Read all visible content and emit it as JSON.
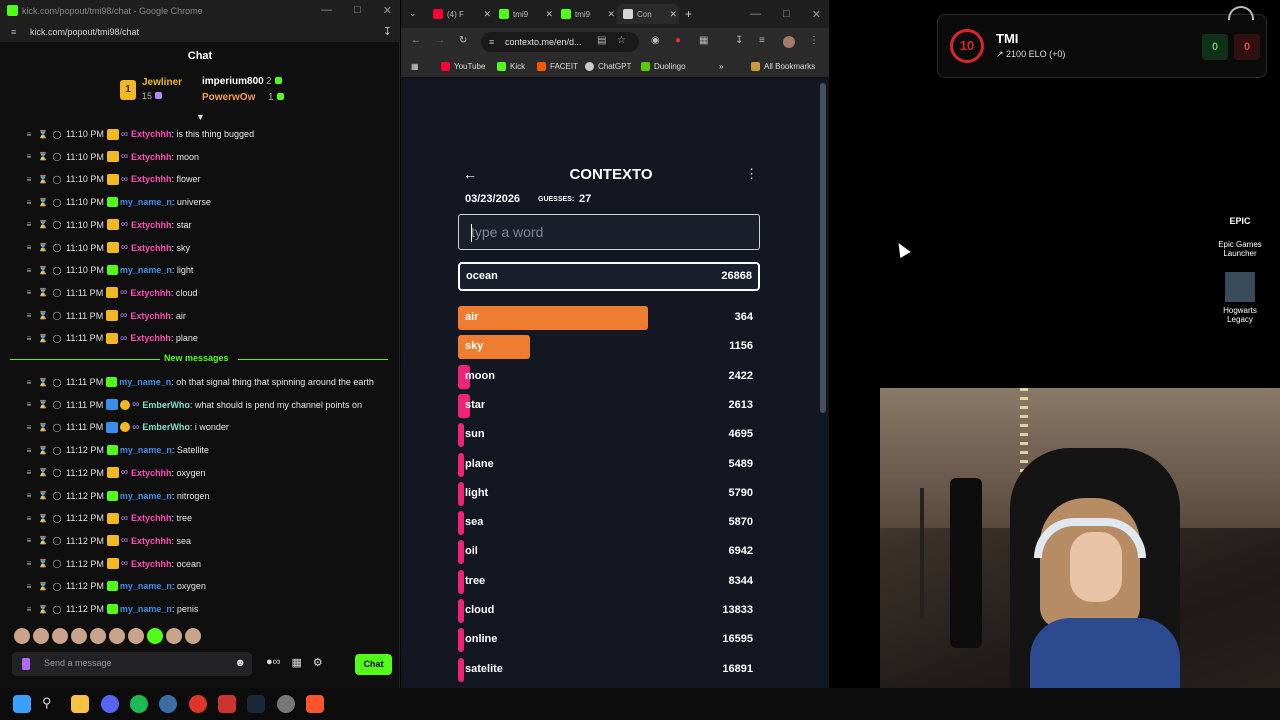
{
  "chat_window": {
    "title": "kick.com/popout/tmi98/chat - Google Chrome",
    "url": "kick.com/popout/tmi98/chat",
    "header": "Chat",
    "leaderboard": {
      "first": {
        "rank": "1",
        "name": "Jewliner",
        "count": "15"
      },
      "second": {
        "name": "imperium800",
        "count": "2"
      },
      "third": {
        "name": "PowerwOw",
        "count": "1"
      }
    },
    "messages_before": [
      {
        "time": "11:10 PM",
        "user": "Extychhh",
        "text": ": is this thing bugged",
        "badge": "crown"
      },
      {
        "time": "11:10 PM",
        "user": "Extychhh",
        "text": ": moon",
        "badge": "crown"
      },
      {
        "time": "11:10 PM",
        "user": "Extychhh",
        "text": ": flower",
        "badge": "crown"
      },
      {
        "time": "11:10 PM",
        "user": "my_name_n",
        "text": ": universe",
        "badge": "green"
      },
      {
        "time": "11:10 PM",
        "user": "Extychhh",
        "text": ": star",
        "badge": "crown"
      },
      {
        "time": "11:10 PM",
        "user": "Extychhh",
        "text": ": sky",
        "badge": "crown"
      },
      {
        "time": "11:10 PM",
        "user": "my_name_n",
        "text": ": light",
        "badge": "green"
      },
      {
        "time": "11:11 PM",
        "user": "Extychhh",
        "text": ": cloud",
        "badge": "crown"
      },
      {
        "time": "11:11 PM",
        "user": "Extychhh",
        "text": ": air",
        "badge": "crown"
      },
      {
        "time": "11:11 PM",
        "user": "Extychhh",
        "text": ": plane",
        "badge": "crown"
      }
    ],
    "new_messages_label": "New messages",
    "messages_after": [
      {
        "time": "11:11 PM",
        "user": "my_name_n",
        "text": ": oh that signal thing that spinning around the earth",
        "badge": "green"
      },
      {
        "time": "11:11 PM",
        "user": "EmberWho",
        "text": ": what should is pend my channel points on",
        "badge": "blue"
      },
      {
        "time": "11:11 PM",
        "user": "EmberWho",
        "text": ": i wonder",
        "badge": "blue"
      },
      {
        "time": "11:12 PM",
        "user": "my_name_n",
        "text": ": Satellite",
        "badge": "green"
      },
      {
        "time": "11:12 PM",
        "user": "Extychhh",
        "text": ": oxygen",
        "badge": "crown"
      },
      {
        "time": "11:12 PM",
        "user": "my_name_n",
        "text": ": nitrogen",
        "badge": "green"
      },
      {
        "time": "11:12 PM",
        "user": "Extychhh",
        "text": ": tree",
        "badge": "crown"
      },
      {
        "time": "11:12 PM",
        "user": "Extychhh",
        "text": ": sea",
        "badge": "crown"
      },
      {
        "time": "11:12 PM",
        "user": "Extychhh",
        "text": ": ocean",
        "badge": "crown"
      },
      {
        "time": "11:12 PM",
        "user": "my_name_n",
        "text": ": oxygen",
        "badge": "green"
      },
      {
        "time": "11:12 PM",
        "user": "my_name_n",
        "text": ": penis",
        "badge": "green"
      }
    ],
    "send_placeholder": "Send a message",
    "send_button": "Chat"
  },
  "browser": {
    "tabs": [
      "(4) F",
      "tmi9",
      "tmi9",
      "Con"
    ],
    "url": "contexto.me/en/d...",
    "bookmarks": [
      "YouTube",
      "Kick",
      "FACEIT",
      "ChatGPT",
      "Duolingo",
      "All Bookmarks"
    ]
  },
  "contexto": {
    "title": "CONTEXTO",
    "date": "03/23/2026",
    "guesses_label": "GUESSES:",
    "guesses": "27",
    "input_placeholder": "type a word",
    "last_guess": {
      "word": "ocean",
      "rank": "26868"
    },
    "guesses_list": [
      {
        "word": "air",
        "rank": "364",
        "fill": 0.63,
        "color": "#ef7d31"
      },
      {
        "word": "sky",
        "rank": "1156",
        "fill": 0.24,
        "color": "#ef7d31"
      },
      {
        "word": "moon",
        "rank": "2422",
        "fill": 0.04,
        "color": "#ef2478"
      },
      {
        "word": "star",
        "rank": "2613",
        "fill": 0.04,
        "color": "#ef2478"
      },
      {
        "word": "sun",
        "rank": "4695",
        "fill": 0.01,
        "color": "#ef2478"
      },
      {
        "word": "plane",
        "rank": "5489",
        "fill": 0.01,
        "color": "#ef2478"
      },
      {
        "word": "light",
        "rank": "5790",
        "fill": 0.01,
        "color": "#ef2478"
      },
      {
        "word": "sea",
        "rank": "5870",
        "fill": 0.01,
        "color": "#ef2478"
      },
      {
        "word": "oil",
        "rank": "6942",
        "fill": 0.01,
        "color": "#ef2478"
      },
      {
        "word": "tree",
        "rank": "8344",
        "fill": 0.01,
        "color": "#ef2478"
      },
      {
        "word": "cloud",
        "rank": "13833",
        "fill": 0.01,
        "color": "#ef2478"
      },
      {
        "word": "online",
        "rank": "16595",
        "fill": 0.01,
        "color": "#ef2478"
      },
      {
        "word": "satelite",
        "rank": "16891",
        "fill": 0.01,
        "color": "#ef2478"
      }
    ]
  },
  "faceit": {
    "level": "10",
    "name": "TMI",
    "elo": "2100 ELO (+0)",
    "wins": "0",
    "losses": "0"
  },
  "desktop_icons": [
    {
      "label": "Epic Games Launcher",
      "logo": "EPIC"
    },
    {
      "label": "Hogwarts Legacy"
    }
  ]
}
